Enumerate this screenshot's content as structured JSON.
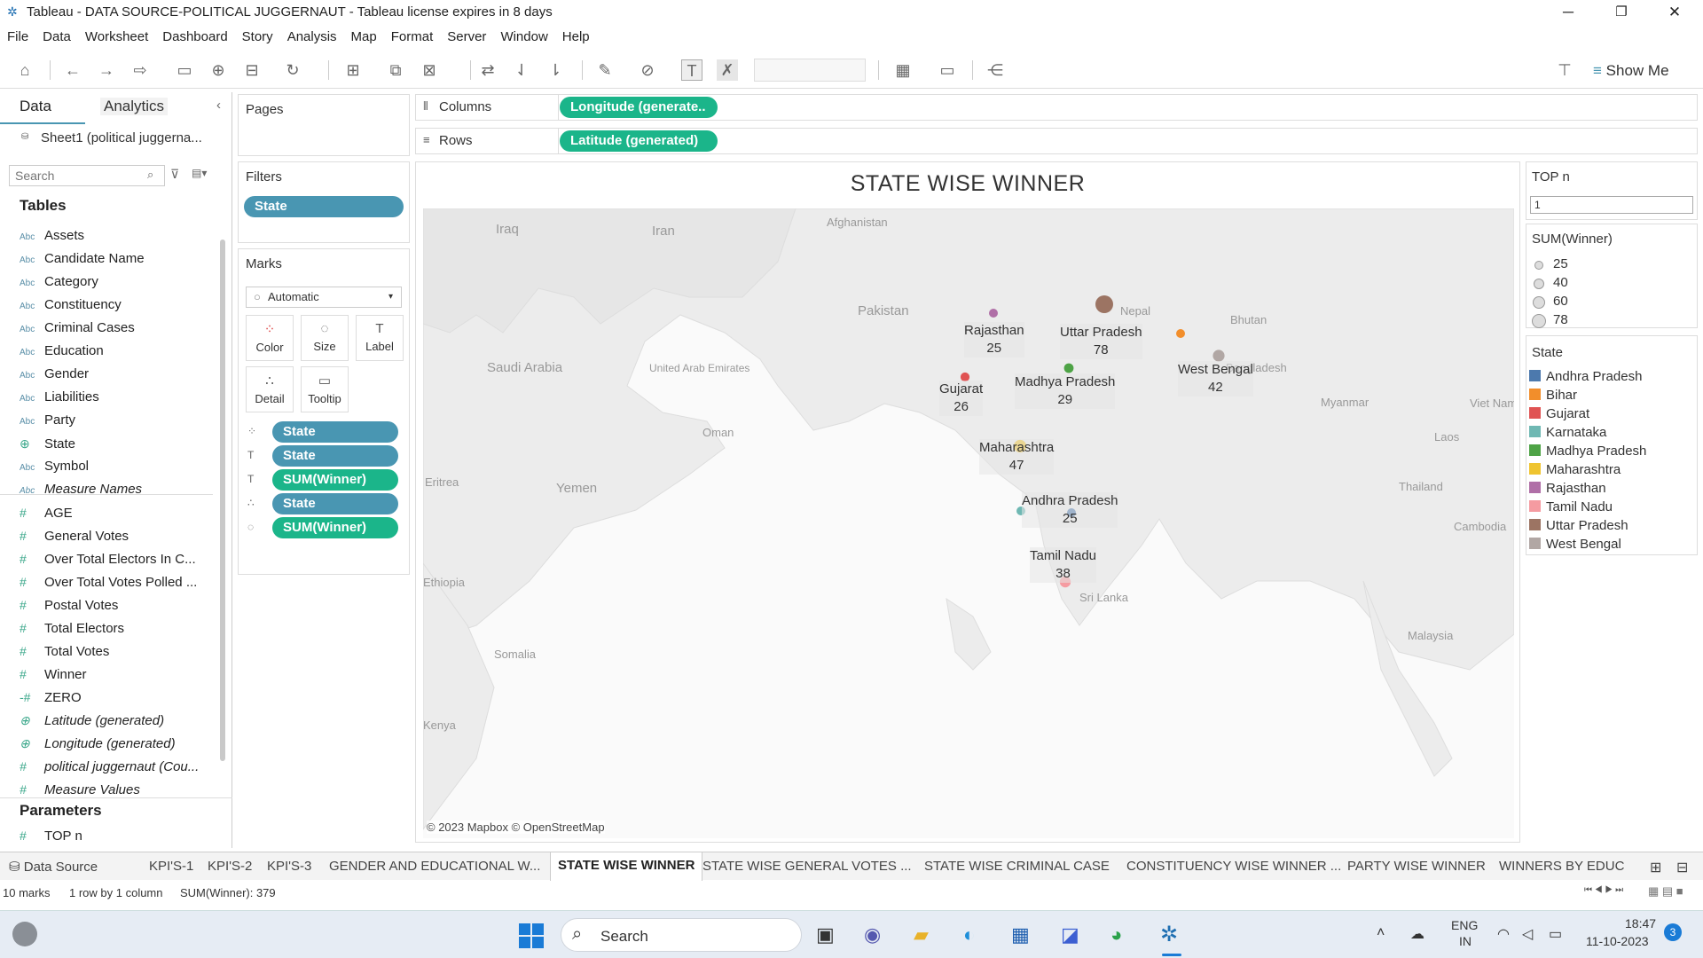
{
  "window": {
    "title": "Tableau - DATA SOURCE-POLITICAL JUGGERNAUT - Tableau license expires in 8 days",
    "minimize": "─",
    "restore": "❐",
    "close": "✕"
  },
  "menu": [
    "File",
    "Data",
    "Worksheet",
    "Dashboard",
    "Story",
    "Analysis",
    "Map",
    "Format",
    "Server",
    "Window",
    "Help"
  ],
  "toolbar": {
    "show_me": "Show Me"
  },
  "left_panel": {
    "tab_data": "Data",
    "tab_analytics": "Analytics",
    "collapse": "‹",
    "datasource": "Sheet1 (political juggerna...",
    "search_placeholder": "Search",
    "tables_heading": "Tables",
    "parameters_heading": "Parameters",
    "dimensions": [
      {
        "icon": "Abc",
        "name": "Assets"
      },
      {
        "icon": "Abc",
        "name": "Candidate Name"
      },
      {
        "icon": "Abc",
        "name": "Category"
      },
      {
        "icon": "Abc",
        "name": "Constituency"
      },
      {
        "icon": "Abc",
        "name": "Criminal Cases"
      },
      {
        "icon": "Abc",
        "name": "Education"
      },
      {
        "icon": "Abc",
        "name": "Gender"
      },
      {
        "icon": "Abc",
        "name": "Liabilities"
      },
      {
        "icon": "Abc",
        "name": "Party"
      },
      {
        "icon": "⊕",
        "name": "State"
      },
      {
        "icon": "Abc",
        "name": "Symbol"
      },
      {
        "icon": "Abc",
        "name": "Measure Names"
      }
    ],
    "measures": [
      {
        "icon": "#",
        "name": "AGE"
      },
      {
        "icon": "#",
        "name": "General Votes"
      },
      {
        "icon": "#",
        "name": "Over Total Electors  In C..."
      },
      {
        "icon": "#",
        "name": "Over Total Votes Polled  ..."
      },
      {
        "icon": "#",
        "name": "Postal Votes"
      },
      {
        "icon": "#",
        "name": "Total Electors"
      },
      {
        "icon": "#",
        "name": "Total Votes"
      },
      {
        "icon": "#",
        "name": "Winner"
      },
      {
        "icon": "-#",
        "name": "ZERO"
      },
      {
        "icon": "⊕",
        "name": "Latitude (generated)"
      },
      {
        "icon": "⊕",
        "name": "Longitude (generated)"
      },
      {
        "icon": "#",
        "name": "political juggernaut (Cou..."
      },
      {
        "icon": "#",
        "name": "Measure Values"
      }
    ],
    "parameters": [
      {
        "icon": "#",
        "name": "TOP n"
      }
    ]
  },
  "pages": {
    "label": "Pages"
  },
  "filters": {
    "label": "Filters",
    "pills": [
      "State"
    ]
  },
  "marks": {
    "label": "Marks",
    "type": "Automatic",
    "buttons": [
      "Color",
      "Size",
      "Label",
      "Detail",
      "Tooltip"
    ],
    "pills": [
      {
        "icon": "⁘",
        "text": "State",
        "color": "blue"
      },
      {
        "icon": "T",
        "text": "State",
        "color": "blue"
      },
      {
        "icon": "T",
        "text": "SUM(Winner)",
        "color": "green"
      },
      {
        "icon": "∴",
        "text": "State",
        "color": "blue"
      },
      {
        "icon": "◌",
        "text": "SUM(Winner)",
        "color": "green"
      }
    ]
  },
  "shelves": {
    "columns_label": "Columns",
    "columns_pill": "Longitude (generate..",
    "rows_label": "Rows",
    "rows_pill": "Latitude (generated)"
  },
  "viz": {
    "title": "STATE WISE WINNER",
    "attribution": "© 2023 Mapbox © OpenStreetMap",
    "geo_labels": [
      "Afghanistan",
      "Iraq",
      "Iran",
      "Pakistan",
      "Nepal",
      "Bhutan",
      "Bangladesh",
      "Saudi Arabia",
      "United Arab Emirates",
      "Oman",
      "Yemen",
      "Myanmar",
      "Laos",
      "Viet Nam",
      "Thailand",
      "Cambodia",
      "Sri Lanka",
      "Malaysia",
      "Ethiopia",
      "Somalia",
      "Eritrea",
      "Kenya"
    ],
    "marks": [
      {
        "state": "Rajasthan",
        "value": 25,
        "color": "#b06fa7"
      },
      {
        "state": "Uttar Pradesh",
        "value": 78,
        "color": "#9c7463"
      },
      {
        "state": "West Bengal",
        "value": 42,
        "color": "#b1a7a4"
      },
      {
        "state": "Gujarat",
        "value": 26,
        "color": "#e05353"
      },
      {
        "state": "Madhya Pradesh",
        "value": 29,
        "color": "#4ea346"
      },
      {
        "state": "Maharashtra",
        "value": 47,
        "color": "#efc430"
      },
      {
        "state": "Andhra Pradesh",
        "value": 25,
        "color": "#4c79ad"
      },
      {
        "state": "Karnataka",
        "value": null,
        "color": "#6fb8b3"
      },
      {
        "state": "Tamil Nadu",
        "value": 38,
        "color": "#f59ba1"
      },
      {
        "state": "Bihar",
        "value": null,
        "color": "#f28e2b"
      }
    ]
  },
  "right_panel": {
    "topn_label": "TOP n",
    "topn_value": "1",
    "size_legend_title": "SUM(Winner)",
    "size_legend": [
      "25",
      "40",
      "60",
      "78"
    ],
    "color_legend_title": "State",
    "color_legend": [
      {
        "name": "Andhra Pradesh",
        "color": "#4c79ad"
      },
      {
        "name": "Bihar",
        "color": "#f28e2b"
      },
      {
        "name": "Gujarat",
        "color": "#e05353"
      },
      {
        "name": "Karnataka",
        "color": "#6fb8b3"
      },
      {
        "name": "Madhya Pradesh",
        "color": "#4ea346"
      },
      {
        "name": "Maharashtra",
        "color": "#efc430"
      },
      {
        "name": "Rajasthan",
        "color": "#b06fa7"
      },
      {
        "name": "Tamil Nadu",
        "color": "#f59ba1"
      },
      {
        "name": "Uttar Pradesh",
        "color": "#9c7463"
      },
      {
        "name": "West Bengal",
        "color": "#b1a7a4"
      }
    ]
  },
  "sheet_tabs": {
    "data_source": "Data Source",
    "tabs": [
      "KPI'S-1",
      "KPI'S-2",
      "KPI'S-3",
      "GENDER AND EDUCATIONAL W...",
      "STATE WISE WINNER",
      "STATE WISE GENERAL VOTES ...",
      "STATE WISE CRIMINAL CASE",
      "CONSTITUENCY WISE WINNER ...",
      "PARTY WISE WINNER",
      "WINNERS BY EDUC"
    ],
    "active": "STATE WISE WINNER"
  },
  "status": {
    "marks": "10 marks",
    "dims": "1 row by 1 column",
    "sum": "SUM(Winner): 379"
  },
  "taskbar": {
    "search": "Search",
    "lang1": "ENG",
    "lang2": "IN",
    "time": "18:47",
    "date": "11-10-2023",
    "badge": "3"
  }
}
